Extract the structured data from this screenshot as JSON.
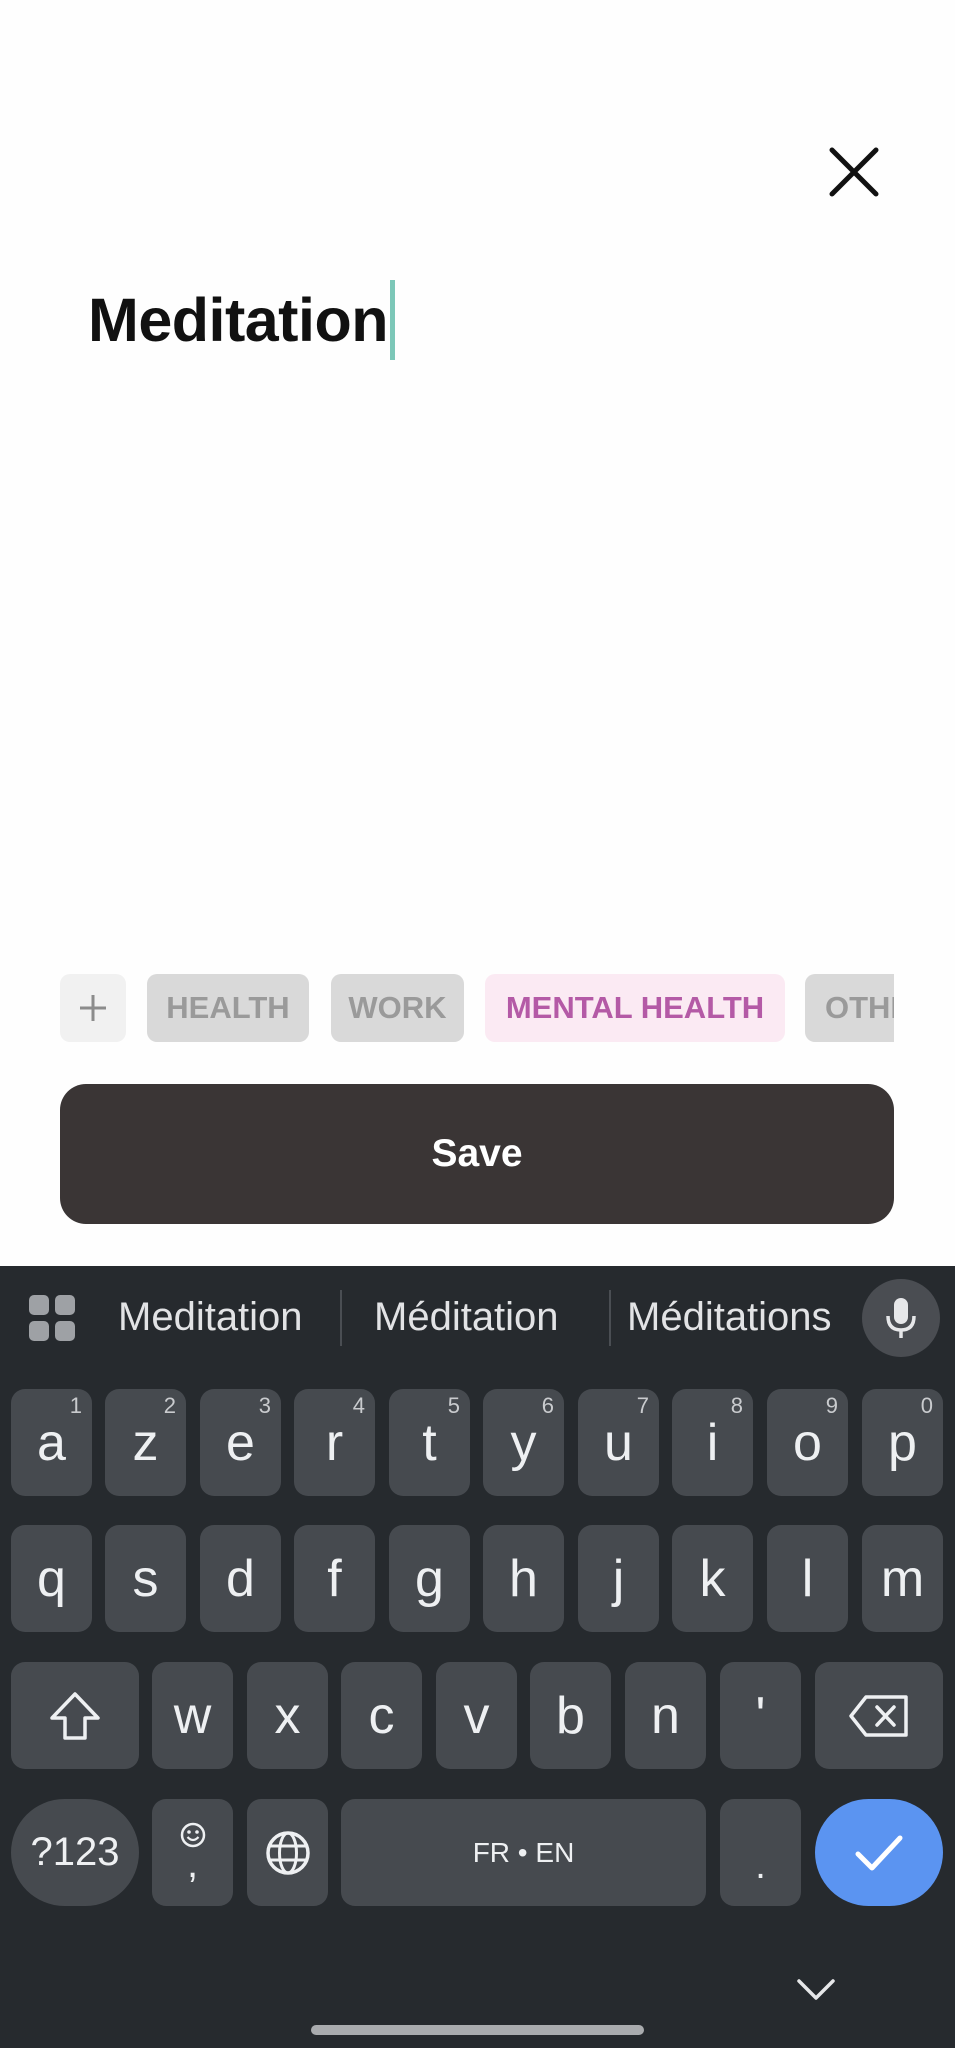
{
  "form": {
    "title_value": "Meditation",
    "close_icon": "close-icon",
    "save_label": "Save"
  },
  "tags": {
    "add_icon": "plus-icon",
    "items": [
      {
        "label": "HEALTH",
        "selected": false
      },
      {
        "label": "WORK",
        "selected": false
      },
      {
        "label": "MENTAL HEALTH",
        "selected": true
      },
      {
        "label": "OTHER",
        "selected": false
      }
    ]
  },
  "keyboard": {
    "suggestions": [
      "Meditation",
      "Méditation",
      "Méditations"
    ],
    "row1": [
      {
        "key": "a",
        "hint": "1"
      },
      {
        "key": "z",
        "hint": "2"
      },
      {
        "key": "e",
        "hint": "3"
      },
      {
        "key": "r",
        "hint": "4"
      },
      {
        "key": "t",
        "hint": "5"
      },
      {
        "key": "y",
        "hint": "6"
      },
      {
        "key": "u",
        "hint": "7"
      },
      {
        "key": "i",
        "hint": "8"
      },
      {
        "key": "o",
        "hint": "9"
      },
      {
        "key": "p",
        "hint": "0"
      }
    ],
    "row2": [
      "q",
      "s",
      "d",
      "f",
      "g",
      "h",
      "j",
      "k",
      "l",
      "m"
    ],
    "row3": [
      "w",
      "x",
      "c",
      "v",
      "b",
      "n",
      "'"
    ],
    "symbols_label": "?123",
    "emoji_comma": ",",
    "space_label": "FR • EN",
    "period_label": ".",
    "colors": {
      "keyboard_bg": "#262a2e",
      "key_bg": "#464a4f",
      "enter_bg": "#5b94f1",
      "accent_tag": "#b45aa6",
      "caret": "#7cc7b8"
    }
  }
}
